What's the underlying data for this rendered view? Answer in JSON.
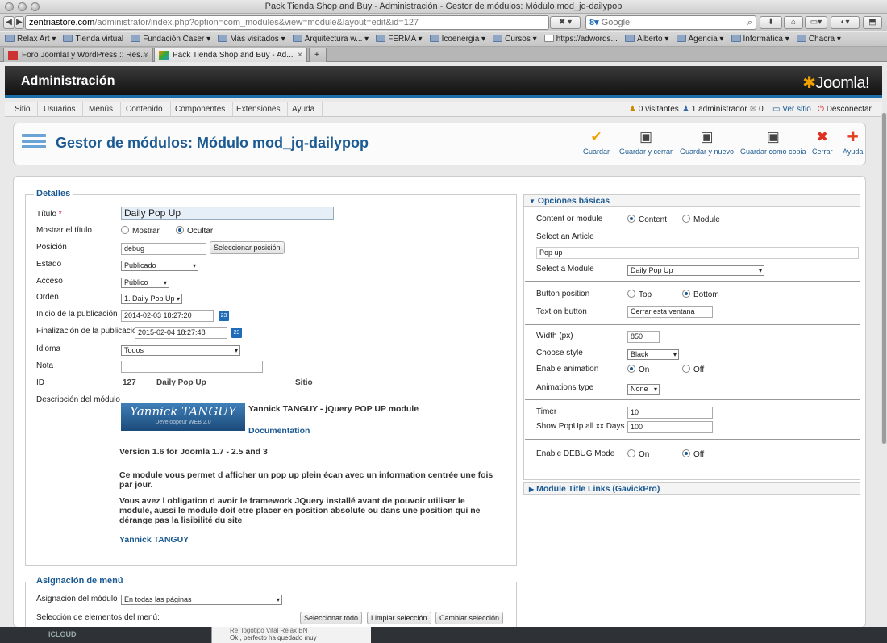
{
  "window": {
    "title": "Pack Tienda Shop and Buy - Administración - Gestor de módulos: Módulo mod_jq-dailypop"
  },
  "browser": {
    "url_domain": "zentriastore.com",
    "url_rest": "/administrator/index.php?option=com_modules&view=module&layout=edit&id=127",
    "search_placeholder": "Google",
    "bookmarks": [
      "Relax Art",
      "Tienda virtual",
      "Fundación Caser",
      "Más visitados",
      "Arquitectura w...",
      "FERMA",
      "Icoenergia",
      "Cursos",
      "https://adwords...",
      "Alberto",
      "Agencia",
      "Informática",
      "Chacra"
    ],
    "tabs": [
      {
        "label": "Foro Joomla! y WordPress :: Res...",
        "active": false
      },
      {
        "label": "Pack Tienda Shop and Buy - Ad...",
        "active": true
      }
    ]
  },
  "header": {
    "title": "Administración",
    "logo": "Joomla!"
  },
  "menu": [
    "Sitio",
    "Usuarios",
    "Menús",
    "Contenido",
    "Componentes",
    "Extensiones",
    "Ayuda"
  ],
  "status": {
    "visitors": "0 visitantes",
    "admins": "1 administrador",
    "messages": "0",
    "view_site": "Ver sitio",
    "logout": "Desconectar"
  },
  "toolbar": {
    "page_title": "Gestor de módulos: Módulo mod_jq-dailypop",
    "buttons": [
      "Guardar",
      "Guardar y cerrar",
      "Guardar y nuevo",
      "Guardar como copia",
      "Cerrar",
      "Ayuda"
    ]
  },
  "details": {
    "legend": "Detalles",
    "title_label": "Título",
    "title_required": "*",
    "title_value": "Daily Pop Up",
    "show_title_label": "Mostrar el título",
    "show_option": "Mostrar",
    "hide_option": "Ocultar",
    "position_label": "Posición",
    "position_value": "debug",
    "position_button": "Seleccionar posición",
    "state_label": "Estado",
    "state_value": "Publicado",
    "access_label": "Acceso",
    "access_value": "Público",
    "order_label": "Orden",
    "order_value": "1. Daily Pop Up",
    "publish_start_label": "Inicio de la publicación",
    "publish_start_value": "2014-02-03 18:27:20",
    "publish_end_label": "Finalización de la publicación",
    "publish_end_value": "2015-02-04 18:27:48",
    "language_label": "Idioma",
    "language_value": "Todos",
    "note_label": "Nota",
    "note_value": "",
    "id_label": "ID",
    "id_value": "127",
    "id_module": "Daily Pop Up",
    "id_site": "Sitio",
    "description_label": "Descripción del módulo",
    "banner_name": "Yannick TANGUY",
    "banner_sub": "Developpeur WEB 2.0",
    "desc_heading": "Yannick TANGUY - jQuery POP UP module",
    "desc_doc_link": "Documentation",
    "desc_version": "Version 1.6 for Joomla 1.7 - 2.5 and 3",
    "desc_p1": "Ce module vous permet d afficher un pop up plein écan avec un information centrée une fois par jour.",
    "desc_p2": "Vous avez l obligation d avoir le framework JQuery installé avant de pouvoir utiliser le module, aussi le module doit etre placer en position absolute ou dans une position qui ne dérange pas la lisibilité du site",
    "desc_author_link": "Yannick TANGUY"
  },
  "menu_assignment": {
    "legend": "Asignación de menú",
    "assignment_label": "Asignación del módulo",
    "assignment_value": "En todas las páginas",
    "selection_label": "Selección de elementos del menú:",
    "select_all": "Seleccionar todo",
    "clear_selection": "Limpiar selección",
    "toggle_selection": "Cambiar selección"
  },
  "basic_options": {
    "header": "Opciones básicas",
    "content_or_module_label": "Content or module",
    "opt_content": "Content",
    "opt_module": "Module",
    "select_article_label": "Select an Article",
    "article_value": "Pop up",
    "select_module_label": "Select a Module",
    "module_value": "Daily Pop Up",
    "button_position_label": "Button position",
    "opt_top": "Top",
    "opt_bottom": "Bottom",
    "text_on_button_label": "Text on button",
    "text_on_button_value": "Cerrar esta ventana",
    "width_label": "Width (px)",
    "width_value": "850",
    "style_label": "Choose style",
    "style_value": "Black",
    "animation_label": "Enable animation",
    "opt_on": "On",
    "opt_off": "Off",
    "animation_type_label": "Animations type",
    "animation_type_value": "None",
    "timer_label": "Timer",
    "timer_value": "10",
    "days_label": "Show PopUp all xx Days",
    "days_value": "100",
    "debug_label": "Enable DEBUG Mode"
  },
  "title_links": {
    "header": "Module Title Links (GavickPro)"
  },
  "background_strip": {
    "left": "ICLOUD",
    "line1": "Re: logotipo Vital Relax BN",
    "line2": "Ok , perfecto ha quedado muy"
  },
  "colors": {
    "accent": "#1b5a92",
    "header_bar": "#1b6ea8",
    "check": "#f0a000",
    "close": "#e03020"
  }
}
